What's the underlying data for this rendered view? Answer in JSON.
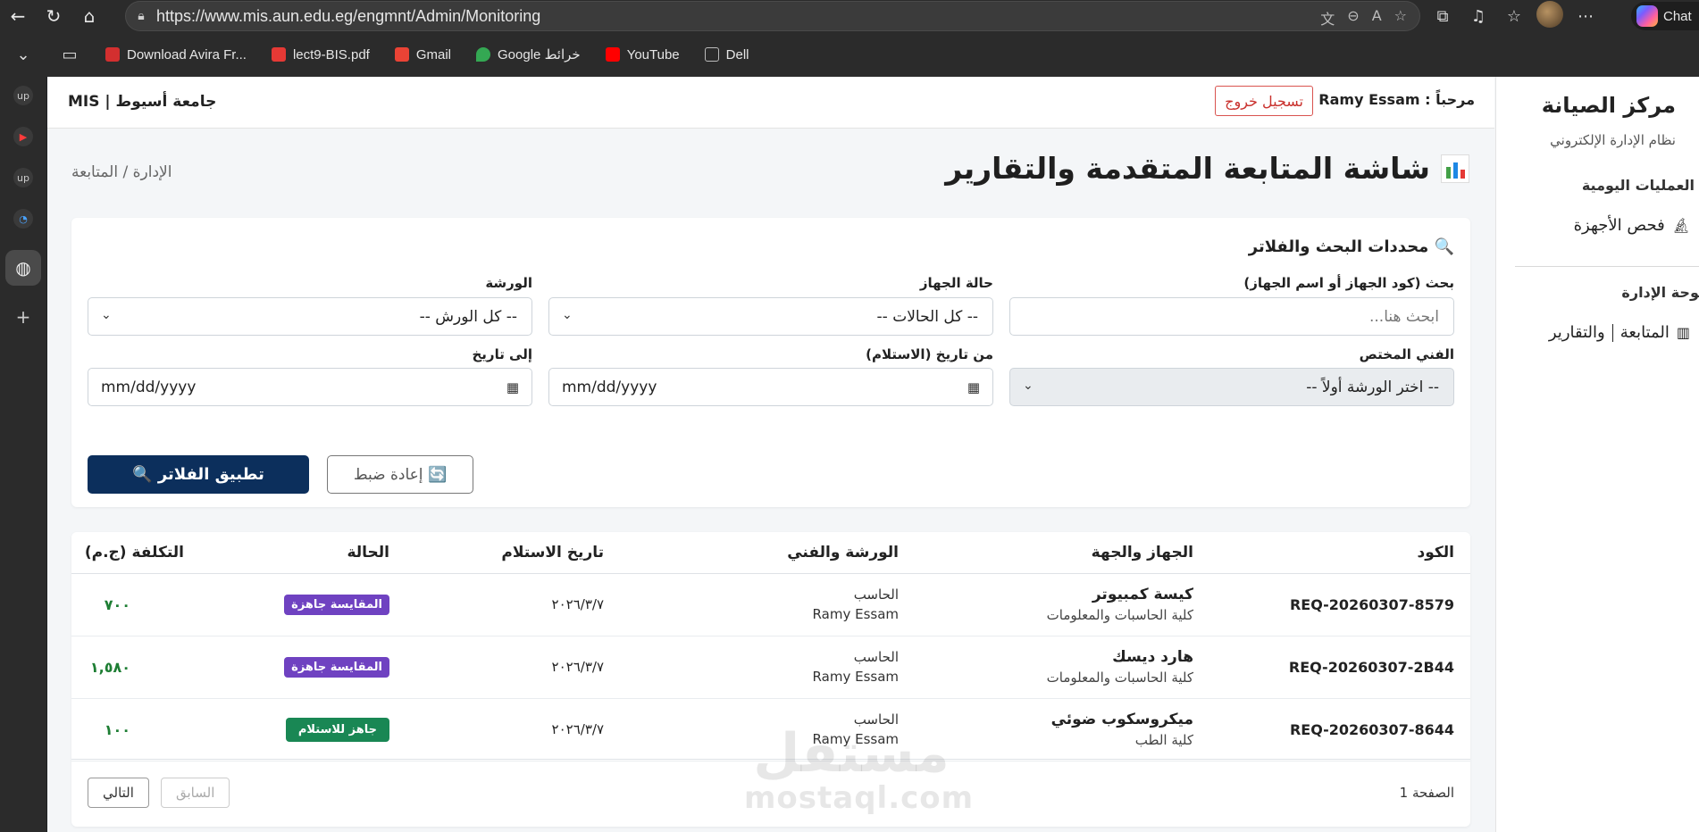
{
  "browser": {
    "url": "https://www.mis.aun.edu.eg/engmnt/Admin/Monitoring",
    "copilot_label": "Chat",
    "bookmarks": [
      {
        "label": "Download Avira Fr...",
        "color": "#d32f2f"
      },
      {
        "label": "lect9-BIS.pdf",
        "color": "#e53935"
      },
      {
        "label": "Gmail",
        "color": "#ea4335"
      },
      {
        "label": "Google خرائط",
        "color": "#34a853"
      },
      {
        "label": "YouTube",
        "color": "#ff0000"
      },
      {
        "label": "Dell",
        "color": "#9e9e9e"
      }
    ],
    "rail_labels": [
      "up",
      "up"
    ]
  },
  "header": {
    "brand": "جامعة أسيوط | MIS",
    "welcome": "مرحباً : Ramy Essam",
    "logout": "تسجيل خروج"
  },
  "page": {
    "title": "شاشة المتابعة المتقدمة والتقارير",
    "breadcrumb": "الإدارة / المتابعة"
  },
  "filters": {
    "title": "🔍 محددات البحث والفلاتر",
    "search_label": "بحث (كود الجهاز أو اسم الجهاز)",
    "search_placeholder": "ابحث هنا...",
    "status_label": "حالة الجهاز",
    "status_value": "-- كل الحالات --",
    "workshop_label": "الورشة",
    "workshop_value": "-- كل الورش --",
    "technician_label": "الفني المختص",
    "technician_value": "-- اختر الورشة أولاً --",
    "from_label": "من تاريخ (الاستلام)",
    "from_placeholder": "mm/dd/yyyy",
    "to_label": "إلى تاريخ",
    "to_placeholder": "mm/dd/yyyy",
    "apply": "تطبيق الفلاتر 🔍",
    "reset": "🔄 إعادة ضبط"
  },
  "table": {
    "headers": [
      "الكود",
      "الجهاز والجهة",
      "الورشة والفني",
      "تاريخ الاستلام",
      "الحالة",
      "التكلفة (ج.م)"
    ],
    "rows": [
      {
        "code": "REQ-20260307-8579",
        "device": "كيسة كمبيوتر",
        "dept": "كلية الحاسبات والمعلومات",
        "workshop": "الحاسب",
        "tech": "Ramy Essam",
        "date": "٢٠٢٦/٣/٧",
        "status": "المقايسة جاهزة",
        "status_color": "#6f42c1",
        "cost": "٧٠٠"
      },
      {
        "code": "REQ-20260307-2B44",
        "device": "هارد ديسك",
        "dept": "كلية الحاسبات والمعلومات",
        "workshop": "الحاسب",
        "tech": "Ramy Essam",
        "date": "٢٠٢٦/٣/٧",
        "status": "المقايسة جاهزة",
        "status_color": "#6f42c1",
        "cost": "١,٥٨٠"
      },
      {
        "code": "REQ-20260307-8644",
        "device": "ميكروسكوب ضوئي",
        "dept": "كلية الطب",
        "workshop": "الحاسب",
        "tech": "Ramy Essam",
        "date": "٢٠٢٦/٣/٧",
        "status": "جاهز للاستلام",
        "status_color": "#198754",
        "cost": "١٠٠"
      }
    ],
    "page_label": "الصفحة 1",
    "prev": "السابق",
    "next": "التالي"
  },
  "watermark": {
    "ar": "مستقل",
    "en": "mostaql.com"
  },
  "sidebar": {
    "title": "مركز الصيانة",
    "subtitle": "نظام الإدارة الإلكتروني",
    "section1": "العمليات اليومية",
    "item1": "فحص الأجهزة",
    "section2": "لوحة الإدارة",
    "item2_part1": "المتابعة",
    "item2_part2": "والتقارير"
  }
}
